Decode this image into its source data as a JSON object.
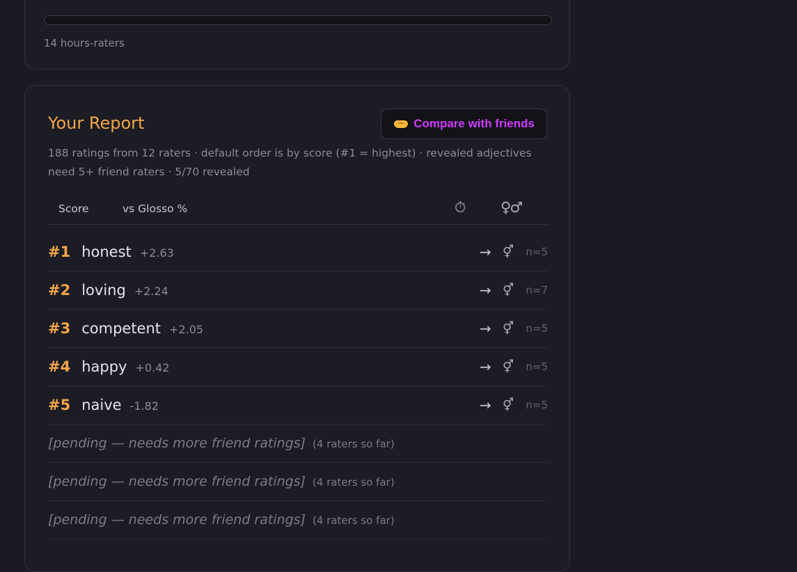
{
  "top_card": {
    "progress_percent": 0,
    "caption": "14 hours-raters"
  },
  "report": {
    "title": "Your Report",
    "compare_label": "Compare with friends",
    "description": "188 ratings from 12 raters · default order is by score (#1 = highest) · revealed adjectives need 5+ friend raters · 5/70 revealed",
    "headers": {
      "score": "Score",
      "glosso": "vs Glosso %",
      "timer_icon": "⏱",
      "gender_icon": "♀♂"
    },
    "rows": [
      {
        "rank": "#1",
        "adjective": "honest",
        "score": "+2.63",
        "arrow": "→",
        "gender": "⚥",
        "count": "n=5"
      },
      {
        "rank": "#2",
        "adjective": "loving",
        "score": "+2.24",
        "arrow": "→",
        "gender": "⚥",
        "count": "n=7"
      },
      {
        "rank": "#3",
        "adjective": "competent",
        "score": "+2.05",
        "arrow": "→",
        "gender": "⚥",
        "count": "n=5"
      },
      {
        "rank": "#4",
        "adjective": "happy",
        "score": "+0.42",
        "arrow": "→",
        "gender": "⚥",
        "count": "n=5"
      },
      {
        "rank": "#5",
        "adjective": "naive",
        "score": "-1.82",
        "arrow": "→",
        "gender": "⚥",
        "count": "n=5"
      }
    ],
    "pending": [
      {
        "text": "[pending — needs more friend ratings]",
        "sub": "(4 raters so far)"
      },
      {
        "text": "[pending — needs more friend ratings]",
        "sub": "(4 raters so far)"
      },
      {
        "text": "[pending — needs more friend ratings]",
        "sub": "(4 raters so far)"
      }
    ]
  },
  "colors": {
    "accent": "#f3a64a",
    "compare": "#cf3cff",
    "background": "#1a1a22",
    "card": "#1c1c24"
  }
}
